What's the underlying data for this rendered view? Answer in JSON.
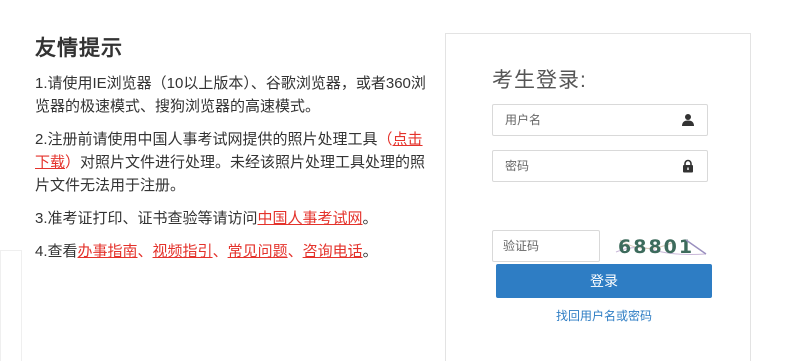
{
  "notice": {
    "title": "友情提示",
    "item1": "1.请使用IE浏览器（10以上版本）、谷歌浏览器，或者360浏览器的极速模式、搜狗浏览器的高速模式。",
    "item2_a": "2.注册前请使用中国人事考试网提供的照片处理工具",
    "item2_paren_open": "（",
    "item2_link": "点击下载",
    "item2_paren_close": "）",
    "item2_b": "对照片文件进行处理。未经该照片处理工具处理的照片文件无法用于注册。",
    "item3_a": "3.准考证打印、证书查验等请访问",
    "item3_link": "中国人事考试网",
    "item3_end": "。",
    "item4_a": "4.查看",
    "item4_link1": "办事指南",
    "item4_sep1": "、",
    "item4_link2": "视频指引",
    "item4_sep2": "、",
    "item4_link3": "常见问题",
    "item4_sep3": "、",
    "item4_link4": "咨询电话",
    "item4_end": "。"
  },
  "login": {
    "title": "考生登录:",
    "username_placeholder": "用户名",
    "password_placeholder": "密码",
    "captcha_placeholder": "验证码",
    "captcha_text": "68801",
    "submit_label": "登录",
    "recover_label": "找回用户名或密码",
    "icons": {
      "username": "user-icon",
      "password": "lock-icon"
    }
  },
  "colors": {
    "accent": "#2e7dc4",
    "link_red": "#e4322b",
    "text": "#333333"
  }
}
